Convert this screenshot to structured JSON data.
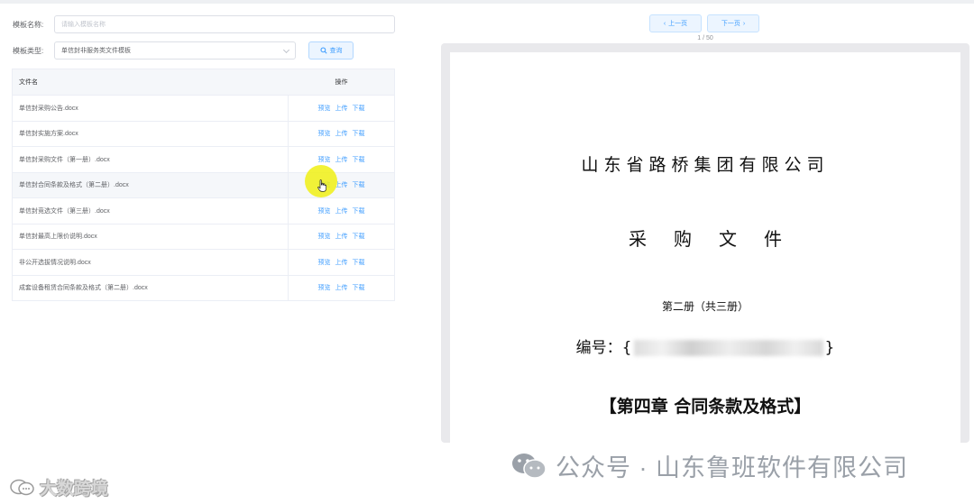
{
  "filters": {
    "name_label": "模板名称:",
    "name_placeholder": "请输入模板名称",
    "type_label": "模板类型:",
    "type_value": "单信封非服务类文件模板",
    "query_label": "查询"
  },
  "table": {
    "col_filename": "文件名",
    "col_actions": "操作",
    "rows": [
      {
        "name": "单信封采购公告.docx"
      },
      {
        "name": "单信封实施方案.docx"
      },
      {
        "name": "单信封采购文件（第一册）.docx"
      },
      {
        "name": "单信封合同条款及格式（第二册）.docx"
      },
      {
        "name": "单信封竞选文件（第三册）.docx"
      },
      {
        "name": "单信封最高上限价说明.docx"
      },
      {
        "name": "非公开选拔情况说明.docx"
      },
      {
        "name": "成套设备租赁合同条款及格式（第二册）.docx"
      }
    ],
    "actions": {
      "preview": "预览",
      "upload": "上传",
      "download": "下载"
    }
  },
  "pager": {
    "prev_label": "上一页",
    "next_label": "下一页",
    "page_info": "1 / 50"
  },
  "document": {
    "company": "山东省路桥集团有限公司",
    "title": "采购文件",
    "volume": "第二册（共三册）",
    "number_prefix": "编号：{",
    "number_suffix": "}",
    "chapter": "【第四章 合同条款及格式】"
  },
  "watermark": {
    "left_text": "大数跨境",
    "right_text": "公众号 · 山东鲁班软件有限公司"
  },
  "colors": {
    "accent": "#409eff",
    "highlight_cursor": "#f0f014"
  }
}
